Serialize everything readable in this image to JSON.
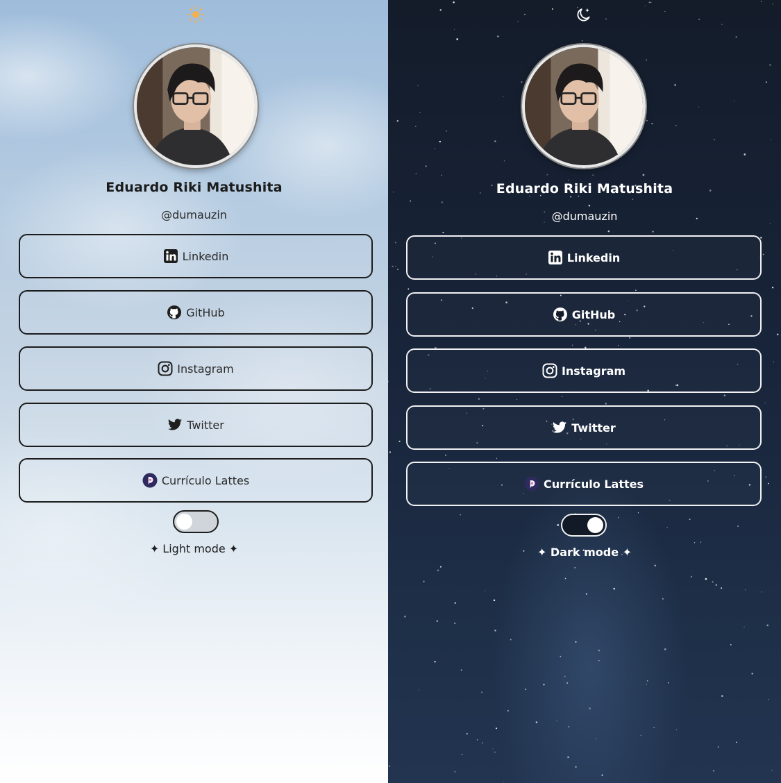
{
  "profile": {
    "name": "Eduardo Riki Matushita",
    "handle": "@dumauzin"
  },
  "links": [
    {
      "label": "Linkedin",
      "icon": "linkedin-icon"
    },
    {
      "label": "GitHub",
      "icon": "github-icon"
    },
    {
      "label": "Instagram",
      "icon": "instagram-icon"
    },
    {
      "label": "Twitter",
      "icon": "twitter-icon"
    },
    {
      "label": "Currículo Lattes",
      "icon": "lattes-icon"
    }
  ],
  "light": {
    "mode_label": "✦ Light mode ✦",
    "mode_icon": "sun-icon",
    "toggle_on": false,
    "colors": {
      "sky_top": "#9fbddb",
      "sky_bottom": "#ffffff",
      "sun": "#f5b04a",
      "text": "#1b1b1b"
    }
  },
  "dark": {
    "mode_label": "✦ Dark mode ✦",
    "mode_icon": "moon-icon",
    "toggle_on": true,
    "colors": {
      "sky_top": "#141c2a",
      "sky_bottom": "#223450",
      "text": "#ffffff"
    }
  }
}
